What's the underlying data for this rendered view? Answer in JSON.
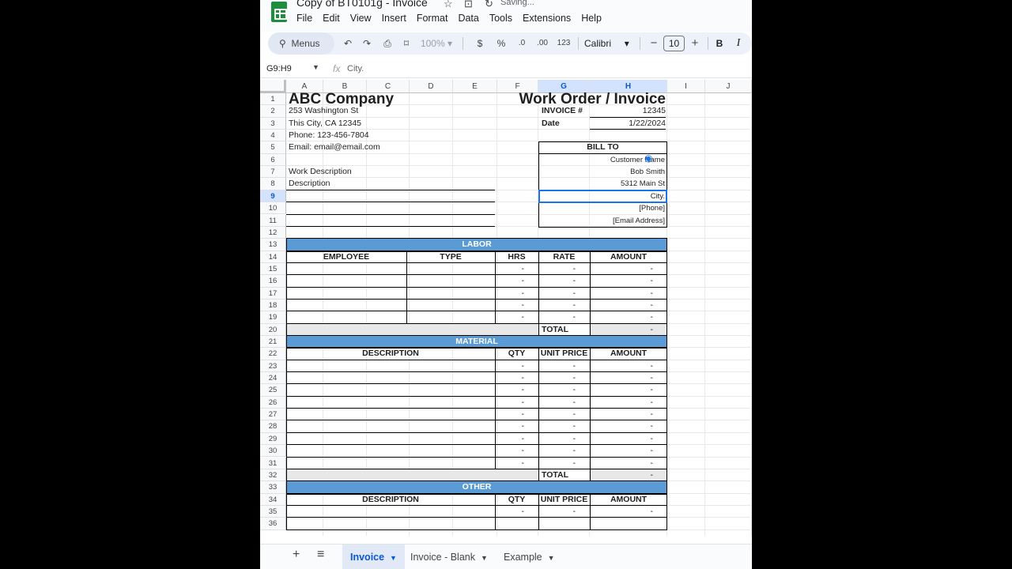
{
  "window": {
    "doc_title": "Copy of BT0101g - Invoice",
    "status": "Saving..."
  },
  "menu": [
    "File",
    "Edit",
    "View",
    "Insert",
    "Format",
    "Data",
    "Tools",
    "Extensions",
    "Help"
  ],
  "toolbar": {
    "search_label": "Menus",
    "zoom": "100%",
    "currency": "$",
    "percent": "%",
    "dec_decrease": ".0",
    "dec_increase": ".00",
    "number_format": "123",
    "font": "Calibri",
    "font_size": "10",
    "bold": "B",
    "italic": "I"
  },
  "formula_bar": {
    "name_box": "G9:H9",
    "fx": "fx",
    "content": "City."
  },
  "columns": [
    "A",
    "B",
    "C",
    "D",
    "E",
    "F",
    "G",
    "H",
    "I",
    "J"
  ],
  "rows": [
    "1",
    "2",
    "3",
    "4",
    "5",
    "6",
    "7",
    "8",
    "9",
    "10",
    "11",
    "12",
    "13",
    "14",
    "15",
    "16",
    "17",
    "18",
    "19",
    "20",
    "21",
    "22",
    "23",
    "24",
    "25",
    "26",
    "27",
    "28",
    "29",
    "30",
    "31",
    "32",
    "33",
    "34",
    "35",
    "36"
  ],
  "invoice": {
    "company": "ABC Company",
    "address1": "253 Washington St",
    "address2": "This City, CA 12345",
    "phone": "Phone: 123-456-7804",
    "email": "Email:  email@email.com",
    "work_description": "Work Description",
    "description": "Description",
    "title": "Work Order / Invoice",
    "invoice_label": "INVOICE #",
    "invoice_no": "12345",
    "date_label": "Date",
    "date": "1/22/2024",
    "bill_to": "BILL TO",
    "customer_name": "Customer Name",
    "contact": "Bob Smith",
    "street": "5312 Main St",
    "city": "City.",
    "phone_ph": "[Phone]",
    "email_ph": "[Email Address]"
  },
  "labor": {
    "band": "LABOR",
    "headers": [
      "EMPLOYEE",
      "TYPE",
      "HRS",
      "RATE",
      "AMOUNT"
    ],
    "dash": "-",
    "total_label": "TOTAL",
    "total_value": "-"
  },
  "material": {
    "band": "MATERIAL",
    "headers": [
      "DESCRIPTION",
      "QTY",
      "UNIT PRICE",
      "AMOUNT"
    ],
    "total_label": "TOTAL",
    "total_value": "-"
  },
  "other": {
    "band": "OTHER",
    "headers": [
      "DESCRIPTION",
      "QTY",
      "UNIT PRICE",
      "AMOUNT"
    ]
  },
  "tabs": {
    "add": "+",
    "list": "≡",
    "sheets": [
      "Invoice",
      "Invoice - Blank",
      "Example"
    ]
  },
  "colors": {
    "band_blue": "#5b9bd5",
    "selection": "#1a73e8",
    "sheets_green": "#1e8e3e"
  }
}
